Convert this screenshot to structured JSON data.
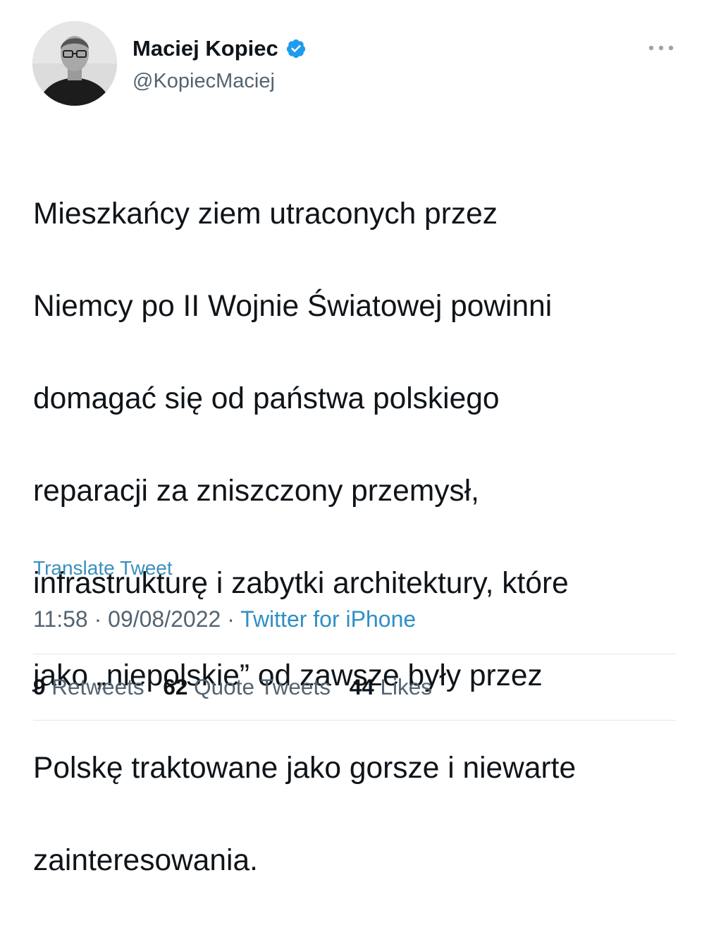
{
  "author": {
    "display_name": "Maciej Kopiec",
    "handle": "@KopiecMaciej",
    "verified": true,
    "avatar_icon": "profile-photo"
  },
  "tweet": {
    "text_lines": [
      "Mieszkańcy ziem utraconych przez",
      "Niemcy po II Wojnie Światowej powinni",
      "domagać się od państwa polskiego",
      "reparacji za zniszczony przemysł,",
      "infrastrukturę i zabytki architektury, które",
      "jako „niepolskie” od zawsze były przez",
      "Polskę traktowane jako gorsze i niewarte",
      "zainteresowania."
    ],
    "translate_label": "Translate Tweet",
    "time": "11:58",
    "separator": " · ",
    "date": "09/08/2022",
    "source": "Twitter for iPhone"
  },
  "stats": {
    "retweets_count": "9",
    "retweets_label": " Retweets",
    "quote_tweets_count": "62",
    "quote_tweets_label": " Quote Tweets",
    "likes_count": "44",
    "likes_label": " Likes"
  },
  "colors": {
    "text": "#0f1419",
    "secondary": "#536471",
    "link": "#1d9bf0",
    "verified": "#1d9bf0"
  },
  "icons": {
    "more": "more-horizontal-icon",
    "verified": "verified-badge-icon"
  }
}
